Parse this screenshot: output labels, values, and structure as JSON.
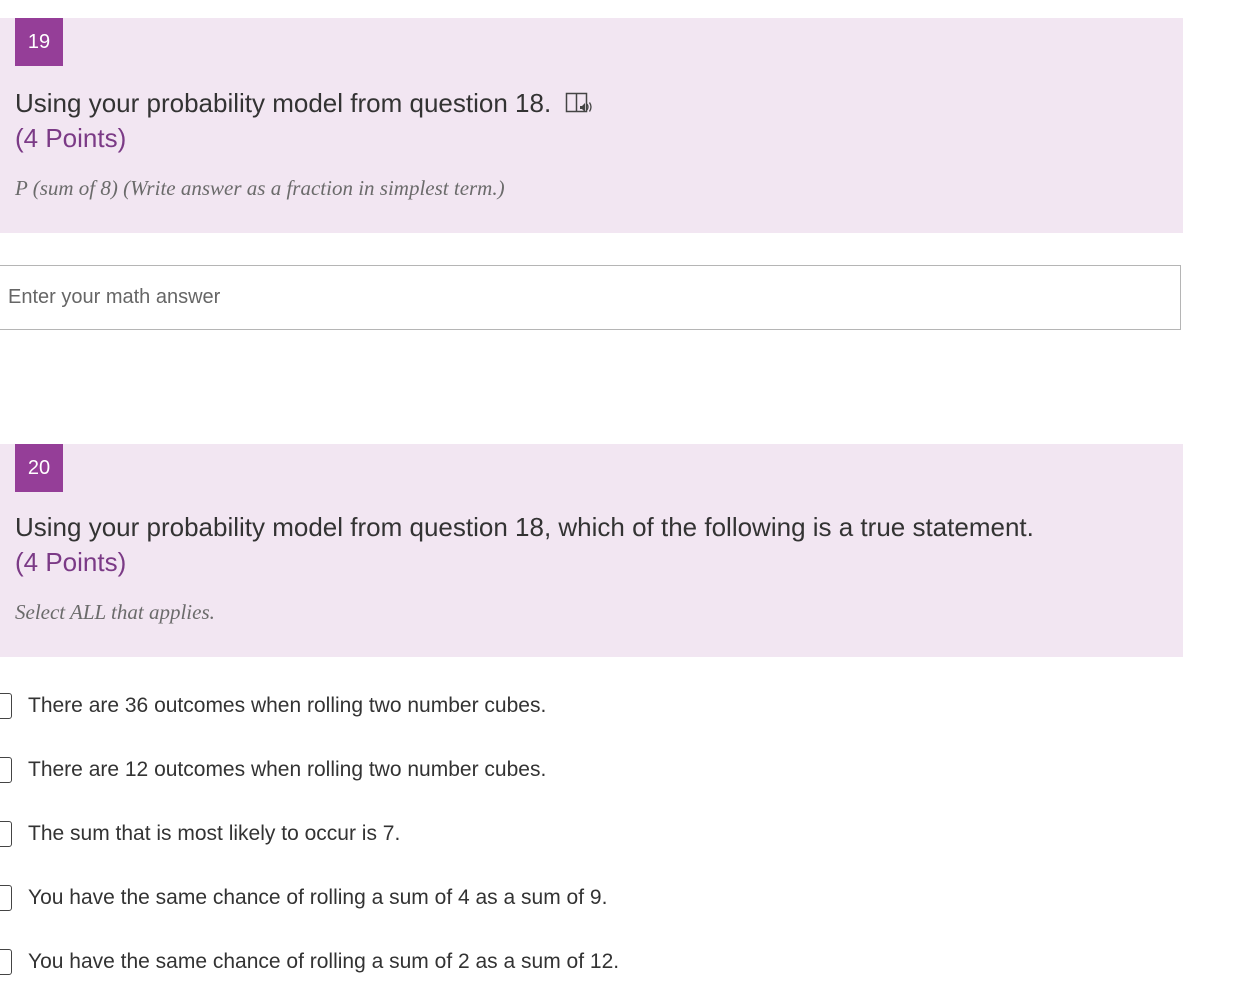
{
  "q19": {
    "number": "19",
    "title": "Using your probability model from question 18.",
    "points": "(4 Points)",
    "subtitle": "P (sum of 8)  (Write answer as a fraction in simplest term.)",
    "answer_placeholder": "Enter your math answer",
    "answer_value": ""
  },
  "q20": {
    "number": "20",
    "title": "Using your probability model from question 18, which of the following is a true statement.",
    "points": "(4 Points)",
    "subtitle": "Select ALL that applies.",
    "options": [
      {
        "label": "There are 36 outcomes when rolling two number cubes.",
        "checked": false
      },
      {
        "label": "There are 12 outcomes when rolling two number cubes.",
        "checked": false
      },
      {
        "label": "The sum that is most likely to occur is 7.",
        "checked": false
      },
      {
        "label": "You have the same chance of rolling a sum of 4 as a sum of 9.",
        "checked": false
      },
      {
        "label": "You have the same chance of rolling a sum of 2 as a sum of 12.",
        "checked": false
      }
    ]
  },
  "icons": {
    "immersive_reader": "immersive-reader-icon"
  },
  "colors": {
    "header_bg": "#f2e6f2",
    "badge_bg": "#953e98",
    "points_text": "#7b3a86"
  }
}
